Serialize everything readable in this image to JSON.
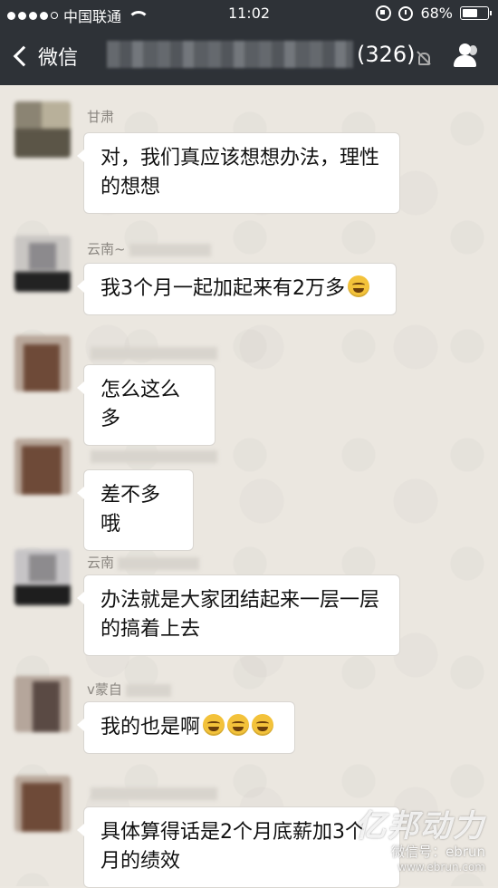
{
  "status_bar": {
    "carrier": "中国联通",
    "time": "11:02",
    "battery": "68%",
    "battery_level": 0.68
  },
  "nav": {
    "back_label": "微信",
    "member_count": "(326)"
  },
  "messages": [
    {
      "sender": "甘肃",
      "text": "对，我们真应该想想办法，理性的想想",
      "emoji_count": 0
    },
    {
      "sender": "云南~",
      "text": "我3个月一起加起来有2万多",
      "emoji_count": 1
    },
    {
      "sender": "",
      "text": "怎么这么多",
      "emoji_count": 0
    },
    {
      "sender": "",
      "text": "差不多哦",
      "emoji_count": 0
    },
    {
      "sender": "云南",
      "text": "办法就是大家团结起来一层一层的搞着上去",
      "emoji_count": 0
    },
    {
      "sender": "v蒙自",
      "text": "我的也是啊",
      "emoji_count": 3
    },
    {
      "sender": "",
      "text": "具体算得话是2个月底薪加3个月的绩效",
      "emoji_count": 0
    }
  ],
  "watermark": {
    "brand": "亿邦动力",
    "account": "微信号：ebrun",
    "url": "www.ebrun.com"
  }
}
